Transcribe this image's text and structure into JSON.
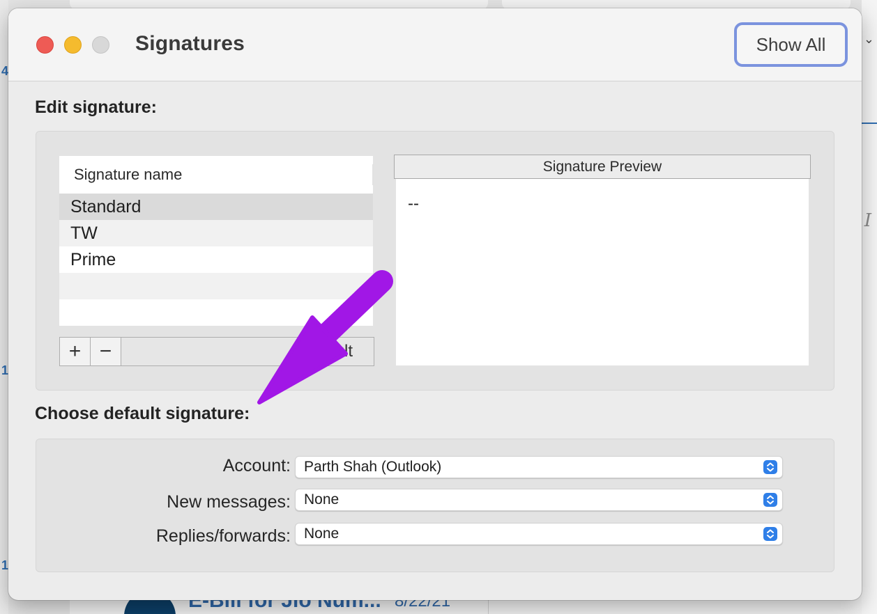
{
  "background": {
    "left_numbers": [
      "4",
      "1",
      "1"
    ],
    "mail_subject": "E-Bill for Jio Num...",
    "mail_date": "8/22/21"
  },
  "window": {
    "title": "Signatures",
    "show_all_label": "Show All"
  },
  "edit_section": {
    "title": "Edit signature:",
    "list_header": "Signature name",
    "signatures": [
      "Standard",
      "TW",
      "Prime"
    ],
    "selected": "Standard",
    "add_label": "+",
    "remove_label": "−",
    "toolbar_partial_text": "ult",
    "preview_header": "Signature Preview",
    "preview_text": "--"
  },
  "default_section": {
    "title": "Choose default signature:",
    "account_label": "Account:",
    "account_value": "Parth Shah (Outlook)",
    "new_messages_label": "New messages:",
    "new_messages_value": "None",
    "replies_label": "Replies/forwards:",
    "replies_value": "None"
  },
  "colors": {
    "accent": "#2f7fe8",
    "show_all_ring": "#7b93de",
    "annotation_arrow": "#a117e6"
  },
  "icons": {
    "close": "close-traffic-light",
    "minimize": "minimize-traffic-light",
    "zoom": "zoom-traffic-light",
    "popup": "up-down-chevron-icon",
    "annotation": "purple-arrow-icon"
  }
}
